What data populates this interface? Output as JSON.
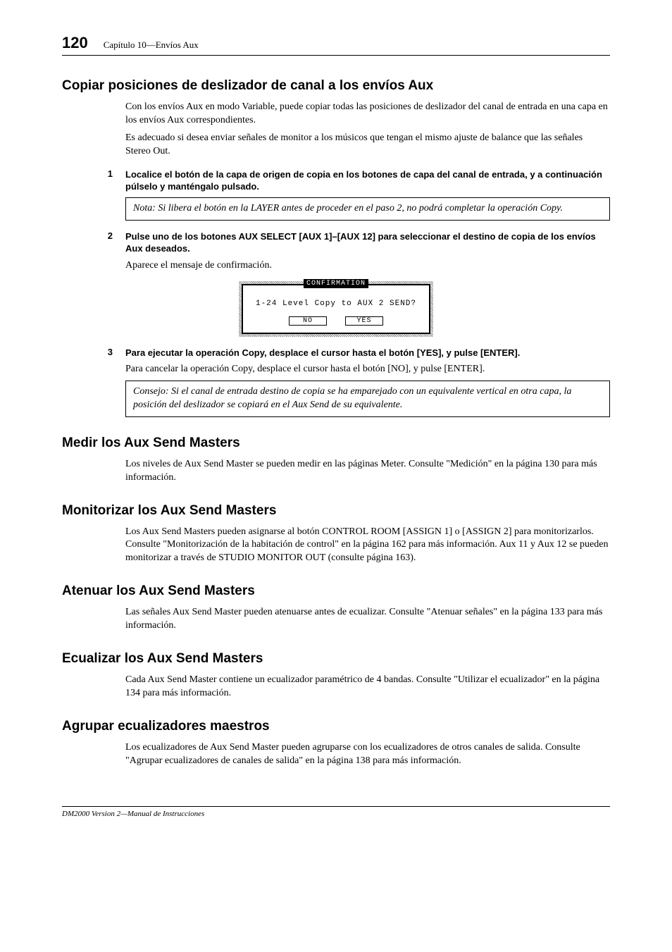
{
  "header": {
    "page_number": "120",
    "chapter": "Capítulo 10—Envíos Aux"
  },
  "sections": {
    "copiar": {
      "title": "Copiar posiciones de deslizador de canal a los envíos Aux",
      "p1": "Con los envíos Aux en modo Variable, puede copiar todas las posiciones de deslizador del canal de entrada en una capa en los envíos Aux correspondientes.",
      "p2": "Es adecuado si desea enviar señales de monitor a los músicos que tengan el mismo ajuste de balance que las señales Stereo Out.",
      "step1_num": "1",
      "step1_text": "Localice el botón de la capa de origen de copia en los botones de capa del canal de entrada, y a continuación púlselo y manténgalo pulsado.",
      "note1": "Nota: Si libera el botón en la LAYER antes de proceder en el paso 2, no podrá completar la operación Copy.",
      "step2_num": "2",
      "step2_text": "Pulse uno de  los botones AUX SELECT [AUX 1]–[AUX 12] para seleccionar el destino de copia de los envíos Aux deseados.",
      "p3": "Aparece el mensaje de confirmación.",
      "step3_num": "3",
      "step3_text": "Para ejecutar la operación Copy, desplace el cursor hasta el botón [YES], y pulse [ENTER].",
      "p4": "Para cancelar la operación Copy, desplace el cursor hasta el botón [NO], y pulse [ENTER].",
      "tip": "Consejo: Si el canal de entrada destino de copia se ha emparejado con un equivalente vertical en otra capa, la posición del deslizador se copiará en el Aux Send de su equivalente."
    },
    "medir": {
      "title": "Medir los Aux Send Masters",
      "p1": "Los niveles de Aux Send Master se pueden medir en las páginas Meter. Consulte  \"Medición\" en la página 130 para más información."
    },
    "monitorizar": {
      "title": "Monitorizar los Aux Send Masters",
      "p1": "Los Aux Send Masters pueden asignarse al botón CONTROL ROOM [ASSIGN 1] o [ASSIGN 2] para monitorizarlos. Consulte  \"Monitorización de la habitación de control\" en la página 162 para más información. Aux 11 y Aux 12 se pueden monitorizar a través de STUDIO MONITOR OUT (consulte página 163)."
    },
    "atenuar": {
      "title": "Atenuar los Aux Send Masters",
      "p1": "Las señales Aux Send Master pueden atenuarse antes de ecualizar. Consulte  \"Atenuar señales\" en la página 133 para más información."
    },
    "ecualizar": {
      "title": "Ecualizar los Aux Send Masters",
      "p1": "Cada Aux Send Master contiene un ecualizador paramétrico de 4 bandas. Consulte  \"Utilizar el ecualizador\" en la página 134 para más información."
    },
    "agrupar": {
      "title": "Agrupar ecualizadores maestros",
      "p1": "Los ecualizadores de Aux Send Master pueden agruparse con los ecualizadores de otros canales de salida. Consulte  \"Agrupar ecualizadores de canales de salida\" en la página 138 para más información."
    }
  },
  "dialog": {
    "title": "CONFIRMATION",
    "message": "1-24 Level Copy to AUX 2 SEND?",
    "no": "NO",
    "yes": "YES"
  },
  "footer": "DM2000 Version 2—Manual de Instrucciones"
}
